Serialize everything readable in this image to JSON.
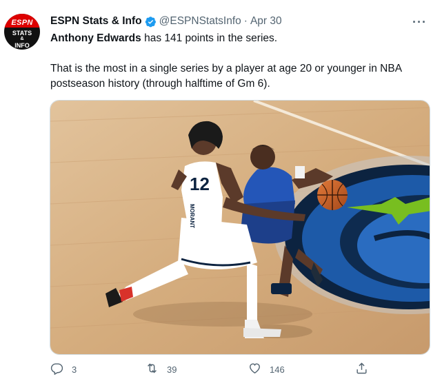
{
  "author": {
    "avatar_lines": [
      "ESPN",
      "STATS",
      "&",
      "INFO"
    ],
    "name": "ESPN Stats & Info",
    "handle": "@ESPNStatsInfo",
    "separator": "·",
    "date": "Apr 30"
  },
  "tweet": {
    "line1_bold": "Anthony Edwards",
    "line1_rest": " has 141 points in the series.",
    "line2": "That is the most in a single series by a player at age 20 or younger in NBA postseason history (through halftime of Gm 6)."
  },
  "media": {
    "jersey_number": "12",
    "jersey_name": "MORANT"
  },
  "actions": {
    "replies": "3",
    "retweets": "39",
    "likes": "146"
  },
  "colors": {
    "verified": "#1d9bf0",
    "text_secondary": "#536471",
    "court": "#d9b58a",
    "logo_blue": "#1d5aa8",
    "logo_navy": "#0c2340",
    "logo_green": "#78be20"
  },
  "icons": [
    "verified-badge-icon",
    "more-icon",
    "reply-icon",
    "retweet-icon",
    "like-icon",
    "share-icon"
  ]
}
